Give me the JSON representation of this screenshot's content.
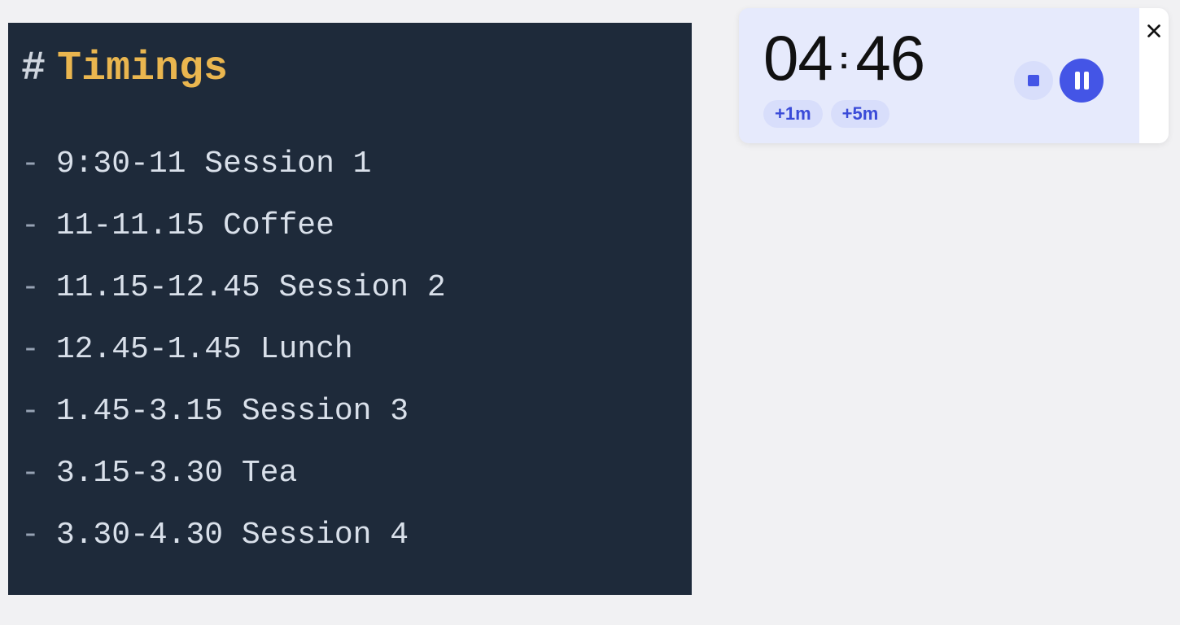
{
  "slide": {
    "heading_prefix": "#",
    "heading": "Timings",
    "items": [
      "9:30-11 Session 1",
      "11-11.15 Coffee",
      "11.15-12.45 Session 2",
      "12.45-1.45 Lunch",
      "1.45-3.15 Session 3",
      "3.15-3.30 Tea",
      "3.30-4.30 Session 4"
    ]
  },
  "timer": {
    "minutes": "04",
    "seconds": "46",
    "add_1m_label": "+1m",
    "add_5m_label": "+5m"
  }
}
